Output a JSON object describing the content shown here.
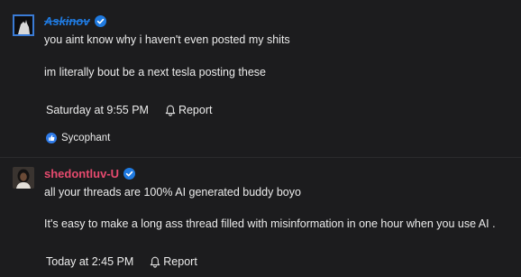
{
  "posts": [
    {
      "username": "Askinov",
      "lines": [
        "you aint know why i haven't even posted my shits",
        "im literally bout be a next tesla posting these"
      ],
      "date": "Saturday at 9:55 PM",
      "report_label": "Report",
      "reaction_label": "Sycophant",
      "username_color": "#1f7ae0"
    },
    {
      "username": "shedontluv-U",
      "lines": [
        "all your threads are 100% AI generated buddy boyo",
        "It's easy to make a long ass thread filled with misinformation in one hour when you use AI ."
      ],
      "date": "Today at 2:45 PM",
      "report_label": "Report",
      "username_color": "#e64a6e"
    }
  ],
  "icons": {
    "verified": "verified-badge-icon",
    "report": "bell-icon",
    "reaction": "like-icon"
  }
}
